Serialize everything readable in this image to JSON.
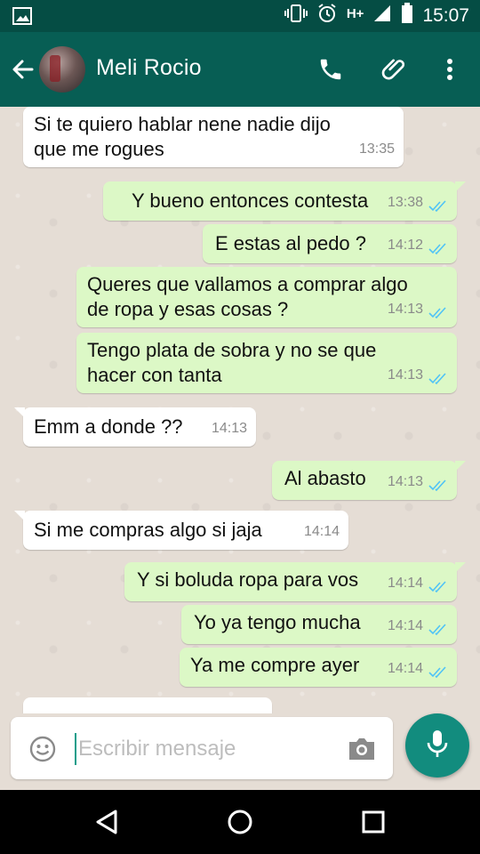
{
  "status_bar": {
    "network_type": "H+",
    "time": "15:07"
  },
  "header": {
    "contact_name": "Meli Rocio",
    "actions": [
      "call-icon",
      "attach-icon",
      "more-icon"
    ]
  },
  "messages": [
    {
      "dir": "in",
      "text": "Si te quiero hablar nene nadie dijo\nque me rogues",
      "time": "13:35"
    },
    {
      "dir": "out",
      "text": "Y bueno entonces contesta",
      "time": "13:38",
      "read": true
    },
    {
      "dir": "out",
      "text": "E estas al pedo ?",
      "time": "14:12",
      "read": true
    },
    {
      "dir": "out",
      "text": "Queres que vallamos a comprar algo\nde ropa y esas cosas ?",
      "time": "14:13",
      "read": true
    },
    {
      "dir": "out",
      "text": "Tengo plata de sobra y no se que\nhacer con tanta",
      "time": "14:13",
      "read": true
    },
    {
      "dir": "in",
      "text": "Emm a donde ??",
      "time": "14:13"
    },
    {
      "dir": "out",
      "text": "Al abasto",
      "time": "14:13",
      "read": true
    },
    {
      "dir": "in",
      "text": "Si me compras algo si jaja",
      "time": "14:14"
    },
    {
      "dir": "out",
      "text": "Y si boluda ropa para vos",
      "time": "14:14",
      "read": true
    },
    {
      "dir": "out",
      "text": "Yo ya tengo mucha",
      "time": "14:14",
      "read": true
    },
    {
      "dir": "out",
      "text": "Ya me compre ayer",
      "time": "14:14",
      "read": true
    }
  ],
  "composer": {
    "placeholder": "Escribir mensaje"
  },
  "colors": {
    "app_bar": "#075e54",
    "status_bar": "#054d44",
    "outgoing_bubble": "#dcf8c6",
    "incoming_bubble": "#ffffff",
    "read_ticks": "#4fc3f7",
    "mic_button": "#128c7e"
  }
}
